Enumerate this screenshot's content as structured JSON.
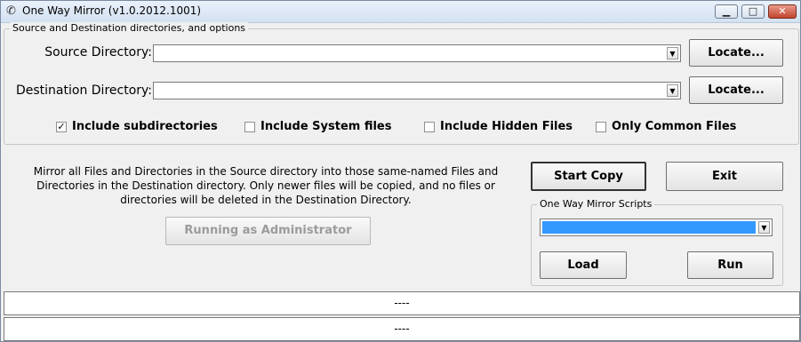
{
  "window": {
    "title": "One Way Mirror (v1.0.2012.1001)",
    "min_glyph": "▁",
    "max_glyph": "□",
    "close_glyph": "✕"
  },
  "options": {
    "group_label": "Source and Destination directories, and options",
    "source_label": "Source Directory:",
    "source_value": "",
    "destination_label": "Destination Directory:",
    "destination_value": "",
    "locate_label": "Locate...",
    "checkboxes": [
      {
        "label": "Include subdirectories",
        "checked": true
      },
      {
        "label": "Include System files",
        "checked": false
      },
      {
        "label": "Include Hidden Files",
        "checked": false
      },
      {
        "label": "Only Common Files",
        "checked": false
      }
    ]
  },
  "description": "Mirror all Files and Directories in the Source directory into those same-named Files and Directories in the Destination directory.  Only newer files will be copied, and no files or directories will be deleted in the Destination Directory.",
  "admin_button": "Running as Administrator",
  "actions": {
    "start_copy": "Start Copy",
    "exit": "Exit"
  },
  "scripts": {
    "group_label": "One Way Mirror Scripts",
    "selected": "",
    "load": "Load",
    "run": "Run"
  },
  "status": {
    "line1": "----",
    "line2": "----"
  },
  "colors": {
    "selection": "#3399ff"
  }
}
